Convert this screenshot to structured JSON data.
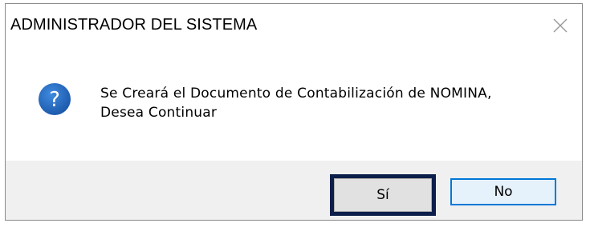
{
  "dialog": {
    "title": "ADMINISTRADOR DEL SISTEMA",
    "message": "Se Creará el Documento de Contabilización de NOMINA,\nDesea Continuar",
    "icon": "question-icon",
    "close_icon": "close-icon",
    "buttons": {
      "yes_label": "Sí",
      "no_label": "No"
    }
  },
  "colors": {
    "icon_blue": "#1e64b4",
    "focus_border": "#0b1f4a",
    "default_button_border": "#0078d7",
    "footer_bg": "#f0f0f0"
  }
}
